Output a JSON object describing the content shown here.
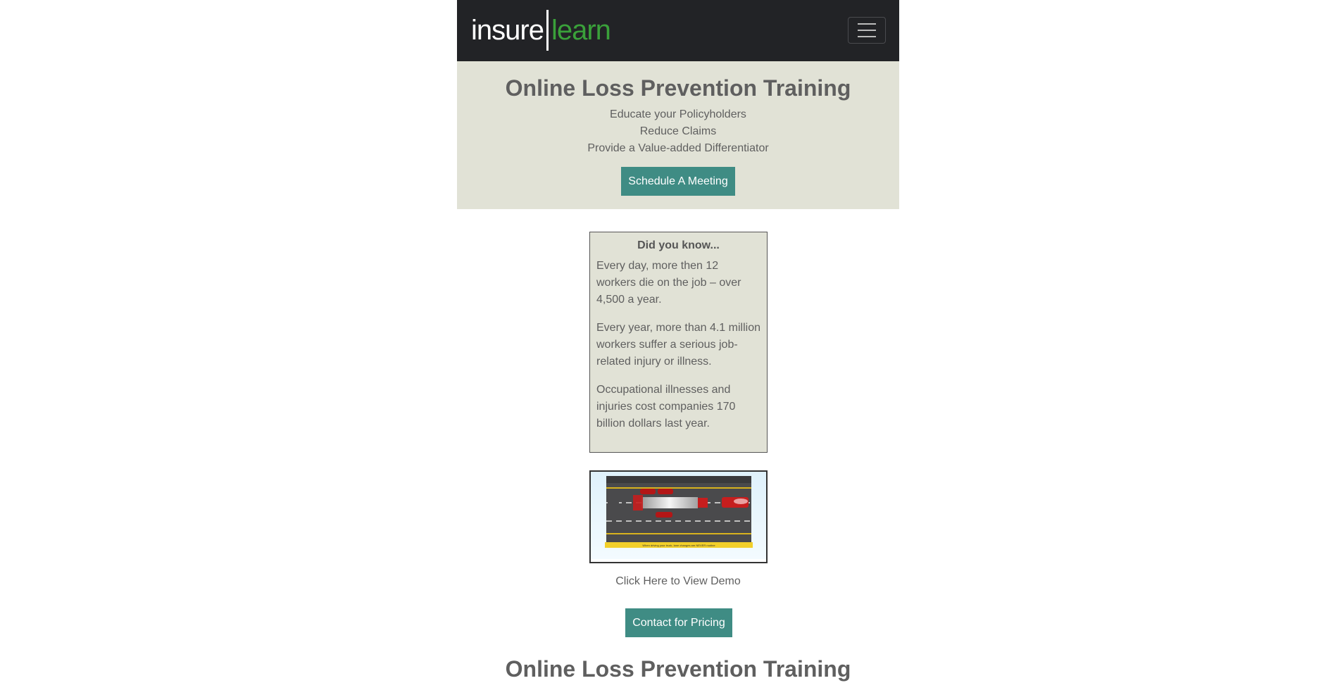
{
  "brand": {
    "logo_left": "insure",
    "logo_right": "learn",
    "accent": "#3aa13a"
  },
  "navbar": {
    "toggler_icon": "hamburger-menu-icon"
  },
  "hero": {
    "title": "Online Loss Prevention Training",
    "lines": [
      "Educate your Policyholders",
      "Reduce Claims",
      "Provide a Value-added Differentiator"
    ],
    "cta_label": "Schedule A Meeting"
  },
  "facts": {
    "heading": "Did you know...",
    "items": [
      "Every day, more then 12 workers die on the job – over 4,500 a year.",
      "Every year, more than 4.1 million workers suffer a serious job-related injury or illness.",
      "Occupational illnesses and injuries cost companies 170 billion dollars last year."
    ]
  },
  "demo": {
    "thumbnail_caption": "When driving your truck, lane changes are NEVER routine",
    "link_label": "Click Here to View Demo"
  },
  "pricing": {
    "button_label": "Contact for Pricing"
  },
  "section": {
    "title": "Online Loss Prevention Training"
  },
  "colors": {
    "navbar": "#222326",
    "hero_bg": "#e1e2d6",
    "button": "#3f8c84"
  }
}
